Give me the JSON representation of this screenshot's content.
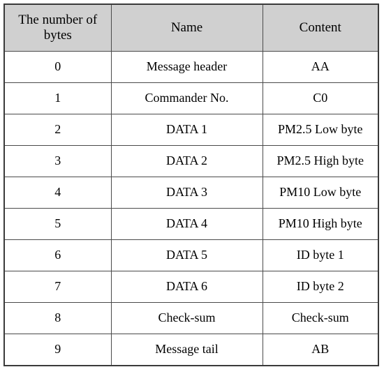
{
  "table": {
    "columns": [
      {
        "key": "bytes",
        "label": "The number of bytes"
      },
      {
        "key": "name",
        "label": "Name"
      },
      {
        "key": "content",
        "label": "Content"
      }
    ],
    "header_background": "#d0d0d0",
    "border_color": "#4a4a4a",
    "rows": [
      {
        "bytes": "0",
        "name": "Message header",
        "content": "AA"
      },
      {
        "bytes": "1",
        "name": "Commander No.",
        "content": "C0"
      },
      {
        "bytes": "2",
        "name": "DATA 1",
        "content": "PM2.5 Low byte"
      },
      {
        "bytes": "3",
        "name": "DATA 2",
        "content": "PM2.5 High byte"
      },
      {
        "bytes": "4",
        "name": "DATA 3",
        "content": "PM10 Low byte"
      },
      {
        "bytes": "5",
        "name": "DATA 4",
        "content": "PM10 High byte"
      },
      {
        "bytes": "6",
        "name": "DATA 5",
        "content": "ID byte 1"
      },
      {
        "bytes": "7",
        "name": "DATA 6",
        "content": "ID byte 2"
      },
      {
        "bytes": "8",
        "name": "Check-sum",
        "content": "Check-sum"
      },
      {
        "bytes": "9",
        "name": "Message tail",
        "content": "AB"
      }
    ]
  }
}
